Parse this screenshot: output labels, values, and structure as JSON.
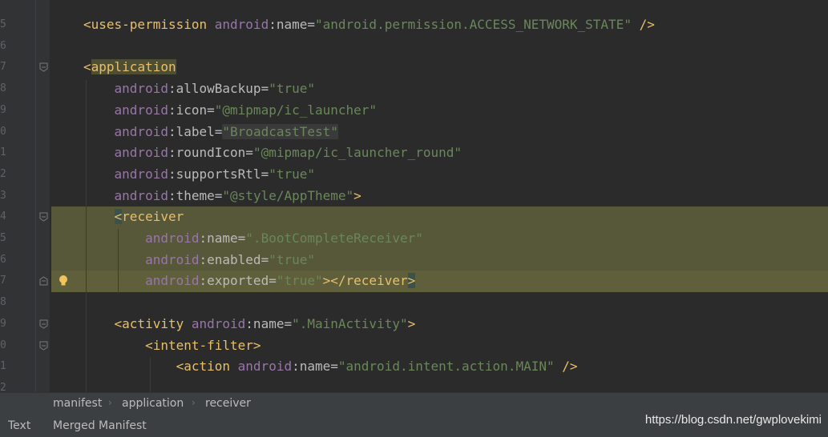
{
  "editor": {
    "lines": [
      {
        "no": "5",
        "tokens": [
          {
            "c": "t",
            "s": "<uses-permission "
          },
          {
            "c": "ns",
            "s": "android"
          },
          {
            "c": "an",
            "s": ":name="
          },
          {
            "c": "v",
            "s": "\"android.permission.ACCESS_NETWORK_STATE\""
          },
          {
            "c": "t",
            "s": " />"
          }
        ]
      },
      {
        "no": "6",
        "tokens": []
      },
      {
        "no": "7",
        "tokens": [
          {
            "c": "t",
            "s": "<"
          },
          {
            "c": "tagbox t",
            "s": "application"
          }
        ]
      },
      {
        "no": "8",
        "tokens": [
          {
            "c": "ns",
            "s": "    android"
          },
          {
            "c": "an",
            "s": ":allowBackup="
          },
          {
            "c": "v",
            "s": "\"true\""
          }
        ]
      },
      {
        "no": "9",
        "tokens": [
          {
            "c": "ns",
            "s": "    android"
          },
          {
            "c": "an",
            "s": ":icon="
          },
          {
            "c": "v",
            "s": "\"@mipmap/ic_launcher\""
          }
        ]
      },
      {
        "no": "0",
        "tokens": [
          {
            "c": "ns",
            "s": "    android"
          },
          {
            "c": "an",
            "s": ":label="
          },
          {
            "c": "valbox v",
            "s": "\"BroadcastTest\""
          }
        ]
      },
      {
        "no": "1",
        "tokens": [
          {
            "c": "ns",
            "s": "    android"
          },
          {
            "c": "an",
            "s": ":roundIcon="
          },
          {
            "c": "v",
            "s": "\"@mipmap/ic_launcher_round\""
          }
        ]
      },
      {
        "no": "2",
        "tokens": [
          {
            "c": "ns",
            "s": "    android"
          },
          {
            "c": "an",
            "s": ":supportsRtl="
          },
          {
            "c": "v",
            "s": "\"true\""
          }
        ]
      },
      {
        "no": "3",
        "tokens": [
          {
            "c": "ns",
            "s": "    android"
          },
          {
            "c": "an",
            "s": ":theme="
          },
          {
            "c": "v",
            "s": "\"@style/AppTheme\""
          },
          {
            "c": "t",
            "s": ">"
          }
        ]
      },
      {
        "no": "4",
        "tokens": [
          {
            "c": "p",
            "s": "    "
          },
          {
            "c": "bracehl t",
            "s": "<"
          },
          {
            "c": "t",
            "s": "receiver"
          }
        ]
      },
      {
        "no": "5",
        "tokens": [
          {
            "c": "ns",
            "s": "        android"
          },
          {
            "c": "an",
            "s": ":name="
          },
          {
            "c": "v",
            "s": "\".BootCompleteReceiver\""
          }
        ]
      },
      {
        "no": "6",
        "tokens": [
          {
            "c": "ns",
            "s": "        android"
          },
          {
            "c": "an",
            "s": ":enabled="
          },
          {
            "c": "v",
            "s": "\"true\""
          }
        ]
      },
      {
        "no": "7",
        "tokens": [
          {
            "c": "ns",
            "s": "        android"
          },
          {
            "c": "an",
            "s": ":exported="
          },
          {
            "c": "v",
            "s": "\"true\""
          },
          {
            "c": "t",
            "s": "></receiver"
          },
          {
            "c": "bracehl t",
            "s": ">"
          }
        ]
      },
      {
        "no": "8",
        "tokens": []
      },
      {
        "no": "9",
        "tokens": [
          {
            "c": "t",
            "s": "    <activity "
          },
          {
            "c": "ns",
            "s": "android"
          },
          {
            "c": "an",
            "s": ":name="
          },
          {
            "c": "v",
            "s": "\".MainActivity\""
          },
          {
            "c": "t",
            "s": ">"
          }
        ]
      },
      {
        "no": "0",
        "tokens": [
          {
            "c": "t",
            "s": "        <intent-filter>"
          }
        ]
      },
      {
        "no": "1",
        "tokens": [
          {
            "c": "t",
            "s": "            <action "
          },
          {
            "c": "ns",
            "s": "android"
          },
          {
            "c": "an",
            "s": ":name="
          },
          {
            "c": "v",
            "s": "\"android.intent.action.MAIN\""
          },
          {
            "c": "t",
            "s": " />"
          }
        ]
      },
      {
        "no": "2",
        "tokens": []
      }
    ]
  },
  "breadcrumb": {
    "items": [
      "manifest",
      "application",
      "receiver"
    ],
    "separator": "›"
  },
  "bottom_tabs": {
    "text": "Text",
    "merged": "Merged Manifest"
  },
  "watermark": "https://blog.csdn.net/gwplovekimi",
  "colors": {
    "background": "#2b2b2b",
    "tag": "#e8bf6a",
    "namespace": "#9876aa",
    "value": "#6a8759",
    "highlight": "#57573a"
  },
  "icons": {
    "fold": "fold-arrow-icon",
    "intention": "lightbulb-icon"
  }
}
